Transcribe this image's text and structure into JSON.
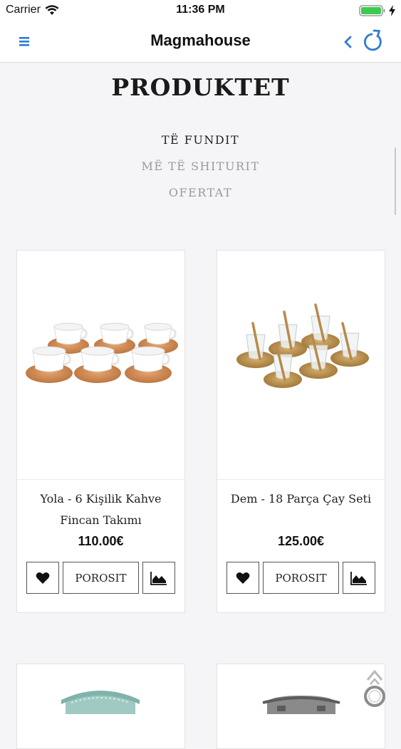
{
  "status_bar": {
    "carrier": "Carrier",
    "time": "11:36 PM"
  },
  "nav": {
    "title": "Magmahouse",
    "accent_color": "#2e7bd6"
  },
  "page": {
    "title": "PRODUKTET",
    "tabs": [
      {
        "label": "TË FUNDIT",
        "active": true
      },
      {
        "label": "MË TË SHITURIT",
        "active": false
      },
      {
        "label": "OFERTAT",
        "active": false
      }
    ]
  },
  "products": [
    {
      "name": "Yola - 6 Kişilik Kahve Fincan Takımı",
      "price": "110.00€",
      "order_label": "POROSIT",
      "image": "coffee-cup-set"
    },
    {
      "name": "Dem - 18 Parça Çay Seti",
      "price": "125.00€",
      "order_label": "POROSIT",
      "image": "tea-glass-set"
    }
  ]
}
